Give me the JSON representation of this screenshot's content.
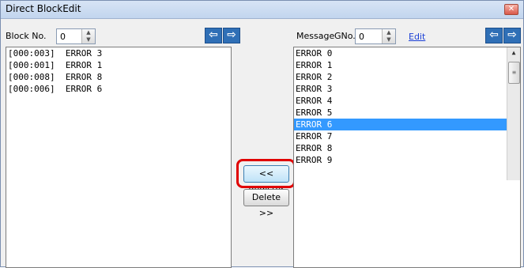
{
  "window": {
    "title": "Direct BlockEdit",
    "close_glyph": "✕"
  },
  "left": {
    "block_label": "Block No.",
    "block_value": "0",
    "arrows": [
      "⇦",
      "⇨"
    ],
    "items": [
      "[000:003]  ERROR 3",
      "[000:001]  ERROR 1",
      "[000:008]  ERROR 8",
      "[000:006]  ERROR 6"
    ]
  },
  "right": {
    "message_label": "Message",
    "gno_label": "GNo.",
    "gno_value": "0",
    "edit_link": "Edit",
    "arrows": [
      "⇦",
      "⇨"
    ],
    "items": [
      "ERROR 0",
      "ERROR 1",
      "ERROR 2",
      "ERROR 3",
      "ERROR 4",
      "ERROR 5",
      "ERROR 6",
      "ERROR 7",
      "ERROR 8",
      "ERROR 9"
    ],
    "selected_index": 6
  },
  "buttons": {
    "register": "<< Register",
    "delete": "Delete >>"
  },
  "colors": {
    "selection": "#3399ff",
    "highlight": "#e00000"
  }
}
